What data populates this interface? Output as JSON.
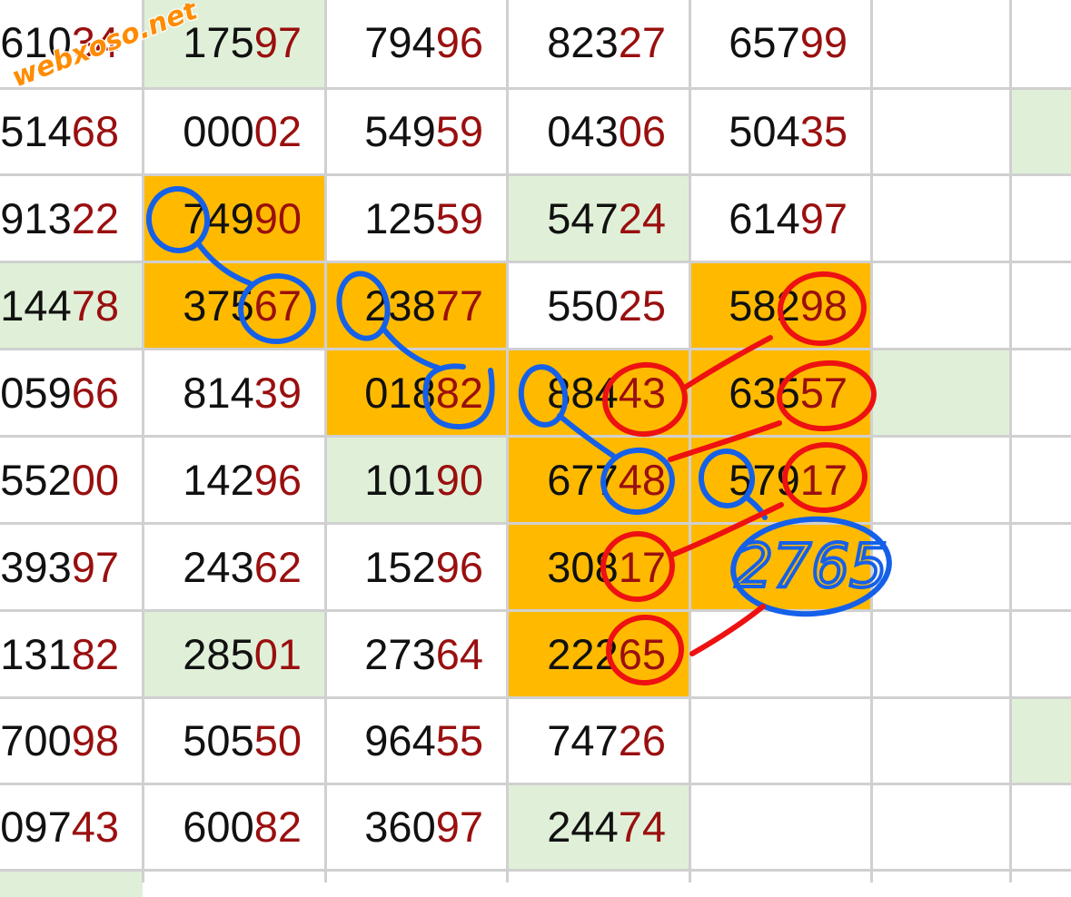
{
  "colors": {
    "highlight": "#ffba00",
    "light_green": "#e0f0d8",
    "white": "#ffffff",
    "grid_line": "#d0d0d0",
    "digit_dark": "#111111",
    "digit_red": "#9a0f0f",
    "pen_blue": "#1560e8",
    "pen_red": "#ee1111",
    "watermark": "#ff8c00"
  },
  "watermark": {
    "text": "webxoso.net"
  },
  "annotation": {
    "handwritten_number": "2765"
  },
  "columns": [
    {
      "name": "col-1",
      "cells": [
        {
          "head": "610",
          "tail": "34",
          "bg": "white"
        },
        {
          "head": "514",
          "tail": "68",
          "bg": "white"
        },
        {
          "head": "913",
          "tail": "22",
          "bg": "white"
        },
        {
          "head": "144",
          "tail": "78",
          "bg": "light_green"
        },
        {
          "head": "059",
          "tail": "66",
          "bg": "white"
        },
        {
          "head": "552",
          "tail": "00",
          "bg": "white"
        },
        {
          "head": "393",
          "tail": "97",
          "bg": "white"
        },
        {
          "head": "131",
          "tail": "82",
          "bg": "white"
        },
        {
          "head": "700",
          "tail": "98",
          "bg": "white"
        },
        {
          "head": "097",
          "tail": "43",
          "bg": "white"
        }
      ]
    },
    {
      "name": "col-2",
      "cells": [
        {
          "head": "175",
          "tail": "97",
          "bg": "light_green"
        },
        {
          "head": "000",
          "tail": "02",
          "bg": "white"
        },
        {
          "head": "749",
          "tail": "90",
          "bg": "highlight"
        },
        {
          "head": "375",
          "tail": "67",
          "bg": "highlight"
        },
        {
          "head": "814",
          "tail": "39",
          "bg": "white"
        },
        {
          "head": "142",
          "tail": "96",
          "bg": "white"
        },
        {
          "head": "243",
          "tail": "62",
          "bg": "white"
        },
        {
          "head": "285",
          "tail": "01",
          "bg": "light_green"
        },
        {
          "head": "505",
          "tail": "50",
          "bg": "white"
        },
        {
          "head": "600",
          "tail": "82",
          "bg": "white"
        }
      ]
    },
    {
      "name": "col-3",
      "cells": [
        {
          "head": "794",
          "tail": "96",
          "bg": "white"
        },
        {
          "head": "549",
          "tail": "59",
          "bg": "white"
        },
        {
          "head": "125",
          "tail": "59",
          "bg": "white"
        },
        {
          "head": "238",
          "tail": "77",
          "bg": "highlight"
        },
        {
          "head": "018",
          "tail": "82",
          "bg": "highlight"
        },
        {
          "head": "101",
          "tail": "90",
          "bg": "light_green"
        },
        {
          "head": "152",
          "tail": "96",
          "bg": "white"
        },
        {
          "head": "273",
          "tail": "64",
          "bg": "white"
        },
        {
          "head": "964",
          "tail": "55",
          "bg": "white"
        },
        {
          "head": "360",
          "tail": "97",
          "bg": "white"
        }
      ]
    },
    {
      "name": "col-4",
      "cells": [
        {
          "head": "823",
          "tail": "27",
          "bg": "white"
        },
        {
          "head": "043",
          "tail": "06",
          "bg": "white"
        },
        {
          "head": "547",
          "tail": "24",
          "bg": "light_green"
        },
        {
          "head": "550",
          "tail": "25",
          "bg": "white"
        },
        {
          "head": "884",
          "tail": "43",
          "bg": "highlight"
        },
        {
          "head": "677",
          "tail": "48",
          "bg": "highlight"
        },
        {
          "head": "308",
          "tail": "17",
          "bg": "highlight"
        },
        {
          "head": "222",
          "tail": "65",
          "bg": "highlight"
        },
        {
          "head": "747",
          "tail": "26",
          "bg": "white"
        },
        {
          "head": "244",
          "tail": "74",
          "bg": "light_green"
        }
      ]
    },
    {
      "name": "col-5",
      "cells": [
        {
          "head": "657",
          "tail": "99",
          "bg": "white"
        },
        {
          "head": "504",
          "tail": "35",
          "bg": "white"
        },
        {
          "head": "614",
          "tail": "97",
          "bg": "white"
        },
        {
          "head": "582",
          "tail": "98",
          "bg": "highlight"
        },
        {
          "head": "635",
          "tail": "57",
          "bg": "highlight"
        },
        {
          "head": "579",
          "tail": "17",
          "bg": "highlight"
        },
        {
          "head": "",
          "tail": "",
          "bg": "highlight"
        },
        {
          "head": "",
          "tail": "",
          "bg": "white"
        },
        {
          "head": "",
          "tail": "",
          "bg": "white"
        },
        {
          "head": "",
          "tail": "",
          "bg": "white"
        }
      ]
    },
    {
      "name": "col-6",
      "cells": [
        {
          "head": "",
          "tail": "",
          "bg": "white"
        },
        {
          "head": "",
          "tail": "",
          "bg": "white"
        },
        {
          "head": "",
          "tail": "",
          "bg": "white"
        },
        {
          "head": "",
          "tail": "",
          "bg": "white"
        },
        {
          "head": "",
          "tail": "",
          "bg": "light_green"
        },
        {
          "head": "",
          "tail": "",
          "bg": "white"
        },
        {
          "head": "",
          "tail": "",
          "bg": "white"
        },
        {
          "head": "",
          "tail": "",
          "bg": "white"
        },
        {
          "head": "",
          "tail": "",
          "bg": "white"
        },
        {
          "head": "",
          "tail": "",
          "bg": "white"
        }
      ]
    },
    {
      "name": "col-7",
      "cells": [
        {
          "head": "",
          "tail": "",
          "bg": "white"
        },
        {
          "head": "",
          "tail": "",
          "bg": "light_green"
        },
        {
          "head": "",
          "tail": "",
          "bg": "white"
        },
        {
          "head": "",
          "tail": "",
          "bg": "white"
        },
        {
          "head": "",
          "tail": "",
          "bg": "white"
        },
        {
          "head": "",
          "tail": "",
          "bg": "white"
        },
        {
          "head": "",
          "tail": "",
          "bg": "white"
        },
        {
          "head": "",
          "tail": "",
          "bg": "white"
        },
        {
          "head": "",
          "tail": "",
          "bg": "light_green"
        },
        {
          "head": "",
          "tail": "",
          "bg": "white"
        }
      ]
    }
  ]
}
